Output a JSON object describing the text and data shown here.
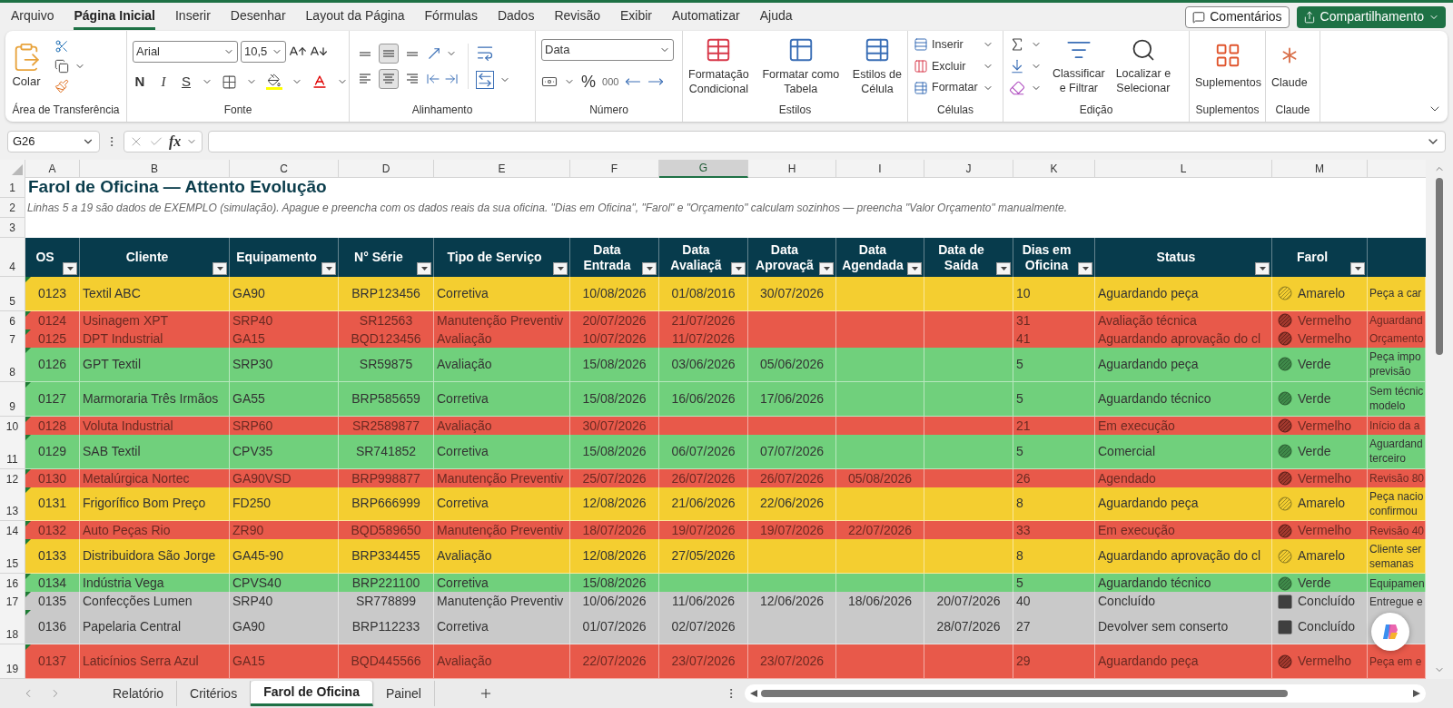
{
  "menu_tabs": [
    {
      "label": "Arquivo",
      "selected": false
    },
    {
      "label": "Página Inicial",
      "selected": true
    },
    {
      "label": "Inserir",
      "selected": false
    },
    {
      "label": "Desenhar",
      "selected": false
    },
    {
      "label": "Layout da Página",
      "selected": false
    },
    {
      "label": "Fórmulas",
      "selected": false
    },
    {
      "label": "Dados",
      "selected": false
    },
    {
      "label": "Revisão",
      "selected": false
    },
    {
      "label": "Exibir",
      "selected": false
    },
    {
      "label": "Automatizar",
      "selected": false
    },
    {
      "label": "Ajuda",
      "selected": false
    }
  ],
  "header_buttons": {
    "comments": "Comentários",
    "share": "Compartilhamento"
  },
  "ribbon": {
    "clipboard": {
      "paste": "Colar",
      "group": "Área de Transferência"
    },
    "font": {
      "name": "Arial",
      "size": "10,5",
      "bold": "N",
      "italic": "I",
      "underline": "S",
      "group": "Fonte"
    },
    "alignment": {
      "vertical": [
        {
          "kind": "top",
          "selected": false
        },
        {
          "kind": "middle",
          "selected": true
        },
        {
          "kind": "bottom",
          "selected": false
        }
      ],
      "horizontal": [
        {
          "kind": "left",
          "selected": false
        },
        {
          "kind": "center",
          "selected": true
        },
        {
          "kind": "right",
          "selected": false
        }
      ],
      "group": "Alinhamento"
    },
    "number": {
      "format": "Data",
      "percent": "%",
      "thousands": "000",
      "group": "Número"
    },
    "styles": {
      "buttons": [
        {
          "lines": [
            "Formatação",
            "Condicional"
          ]
        },
        {
          "lines": [
            "Formatar como",
            "Tabela"
          ]
        },
        {
          "lines": [
            "Estilos de",
            "Célula"
          ]
        }
      ],
      "group": "Estilos"
    },
    "cells": {
      "buttons": [
        "Inserir",
        "Excluir",
        "Formatar"
      ],
      "group": "Células"
    },
    "editing": {
      "buttons": [
        {
          "lines": [
            "Classificar",
            "e Filtrar"
          ]
        },
        {
          "lines": [
            "Localizar e",
            "Selecionar"
          ]
        }
      ],
      "group": "Edição"
    },
    "addins": {
      "button": "Suplementos",
      "group": "Suplementos"
    },
    "claude": {
      "button": "Claude",
      "group": "Claude"
    }
  },
  "formula_bar": {
    "name_box": "G26",
    "fx": "fx"
  },
  "columns": [
    {
      "letter": "A",
      "selected": false
    },
    {
      "letter": "B",
      "selected": false
    },
    {
      "letter": "C",
      "selected": false
    },
    {
      "letter": "D",
      "selected": false
    },
    {
      "letter": "E",
      "selected": false
    },
    {
      "letter": "F",
      "selected": false
    },
    {
      "letter": "G",
      "selected": true
    },
    {
      "letter": "H",
      "selected": false
    },
    {
      "letter": "I",
      "selected": false
    },
    {
      "letter": "J",
      "selected": false
    },
    {
      "letter": "K",
      "selected": false
    },
    {
      "letter": "L",
      "selected": false
    },
    {
      "letter": "M",
      "selected": false
    }
  ],
  "title": {
    "num": "1",
    "text": "Farol de Oficina — Attento Evolução"
  },
  "subtitle": {
    "num": "2",
    "text": "Linhas 5 a 19 são dados de EXEMPLO (simulação). Apague e preencha com os dados reais da sua oficina. \"Dias em Oficina\", \"Farol\" e \"Orçamento\" calculam sozinhos — preencha \"Valor Orçamento\" manualmente."
  },
  "blank_row": {
    "num": "3"
  },
  "table": {
    "num": "4",
    "headers": [
      {
        "lines": [
          "OS"
        ]
      },
      {
        "lines": [
          "Cliente"
        ]
      },
      {
        "lines": [
          "Equipamento"
        ]
      },
      {
        "lines": [
          "N° Série"
        ]
      },
      {
        "lines": [
          "Tipo de Serviço"
        ]
      },
      {
        "lines": [
          "Data",
          "Entrada"
        ]
      },
      {
        "lines": [
          "Data",
          "Avaliaçã"
        ]
      },
      {
        "lines": [
          "Data",
          "Aprovaçã"
        ]
      },
      {
        "lines": [
          "Data",
          "Agendada"
        ]
      },
      {
        "lines": [
          "Data de",
          "Saída"
        ]
      },
      {
        "lines": [
          "Dias em",
          "Oficina"
        ]
      },
      {
        "lines": [
          "Status"
        ]
      },
      {
        "lines": [
          "Farol"
        ]
      }
    ],
    "rows": [
      {
        "num": "5",
        "kind": "yellow",
        "cells": {
          "A": "0123",
          "B": "Textil ABC",
          "C": "GA90",
          "D": "BRP123456",
          "E": "Corretiva",
          "F": "10/08/2026",
          "G": "01/08/2016",
          "H": "30/07/2026",
          "K": "10",
          "L": "Aguardando peça",
          "M": "Amarelo"
        },
        "note": [
          "Peça a car"
        ]
      },
      {
        "num": "6",
        "kind": "red",
        "cells": {
          "A": "0124",
          "B": "Usinagem XPT",
          "C": "SRP40",
          "D": "SR12563",
          "E": "Manutenção Preventiv",
          "F": "20/07/2026",
          "G": "21/07/2026",
          "K": "31",
          "L": "Avaliação técnica",
          "M": "Vermelho"
        },
        "note": [
          "Aguardand"
        ]
      },
      {
        "num": "7",
        "kind": "red",
        "cells": {
          "A": "0125",
          "B": "DPT Industrial",
          "C": "GA15",
          "D": "BQD123456",
          "E": "Avaliação",
          "F": "10/07/2026",
          "G": "11/07/2026",
          "K": "41",
          "L": "Aguardando aprovação do cl",
          "M": "Vermelho"
        },
        "note": [
          "Orçamento"
        ]
      },
      {
        "num": "8",
        "kind": "green",
        "cells": {
          "A": "0126",
          "B": "GPT Textil",
          "C": "SRP30",
          "D": "SR59875",
          "E": "Avaliação",
          "F": "15/08/2026",
          "G": "03/06/2026",
          "H": "05/06/2026",
          "K": "5",
          "L": "Aguardando peça",
          "M": "Verde"
        },
        "note": [
          "Peça impo",
          "previsão"
        ]
      },
      {
        "num": "9",
        "kind": "green",
        "cells": {
          "A": "0127",
          "B": "Marmoraria Três Irmãos",
          "C": "GA55",
          "D": "BRP585659",
          "E": "Corretiva",
          "F": "15/08/2026",
          "G": "16/06/2026",
          "H": "17/06/2026",
          "K": "5",
          "L": "Aguardando técnico",
          "M": "Verde"
        },
        "note": [
          "Sem técnic",
          "modelo"
        ]
      },
      {
        "num": "10",
        "kind": "red",
        "cells": {
          "A": "0128",
          "B": "Voluta Industrial",
          "C": "SRP60",
          "D": "SR2589877",
          "E": "Avaliação",
          "F": "30/07/2026",
          "K": "21",
          "L": "Em execução",
          "M": "Vermelho"
        },
        "note": [
          "Início da a"
        ]
      },
      {
        "num": "11",
        "kind": "green",
        "cells": {
          "A": "0129",
          "B": "SAB Textil",
          "C": "CPV35",
          "D": "SR741852",
          "E": "Corretiva",
          "F": "15/08/2026",
          "G": "06/07/2026",
          "H": "07/07/2026",
          "K": "5",
          "L": "Comercial",
          "M": "Verde"
        },
        "note": [
          "Aguardand",
          "terceiro"
        ]
      },
      {
        "num": "12",
        "kind": "red",
        "cells": {
          "A": "0130",
          "B": "Metalúrgica Nortec",
          "C": "GA90VSD",
          "D": "BRP998877",
          "E": "Manutenção Preventiv",
          "F": "25/07/2026",
          "G": "26/07/2026",
          "H": "26/07/2026",
          "I": "05/08/2026",
          "K": "26",
          "L": "Agendado",
          "M": "Vermelho"
        },
        "note": [
          "Revisão 80"
        ]
      },
      {
        "num": "13",
        "kind": "yellow",
        "cells": {
          "A": "0131",
          "B": "Frigorífico Bom Preço",
          "C": "FD250",
          "D": "BRP666999",
          "E": "Corretiva",
          "F": "12/08/2026",
          "G": "21/06/2026",
          "H": "22/06/2026",
          "K": "8",
          "L": "Aguardando peça",
          "M": "Amarelo"
        },
        "note": [
          "Peça nacio",
          "confirmou"
        ]
      },
      {
        "num": "14",
        "kind": "red",
        "cells": {
          "A": "0132",
          "B": "Auto Peças Rio",
          "C": "ZR90",
          "D": "BQD589650",
          "E": "Manutenção Preventiv",
          "F": "18/07/2026",
          "G": "19/07/2026",
          "H": "19/07/2026",
          "I": "22/07/2026",
          "K": "33",
          "L": "Em execução",
          "M": "Vermelho"
        },
        "note": [
          "Revisão 40"
        ]
      },
      {
        "num": "15",
        "kind": "yellow",
        "cells": {
          "A": "0133",
          "B": "Distribuidora São Jorge",
          "C": "GA45-90",
          "D": "BRP334455",
          "E": "Avaliação",
          "F": "12/08/2026",
          "G": "27/05/2026",
          "K": "8",
          "L": "Aguardando aprovação do cl",
          "M": "Amarelo"
        },
        "note": [
          "Cliente ser",
          "semanas"
        ]
      },
      {
        "num": "16",
        "kind": "green",
        "cells": {
          "A": "0134",
          "B": "Indústria Vega",
          "C": "CPVS40",
          "D": "BRP221100",
          "E": "Corretiva",
          "F": "15/08/2026",
          "K": "5",
          "L": "Aguardando técnico",
          "M": "Verde"
        },
        "note": [
          "Equipamen"
        ]
      },
      {
        "num": "17",
        "kind": "done",
        "cells": {
          "A": "0135",
          "B": "Confecções Lumen",
          "C": "SRP40",
          "D": "SR778899",
          "E": "Manutenção Preventiv",
          "F": "10/06/2026",
          "G": "11/06/2026",
          "H": "12/06/2026",
          "I": "18/06/2026",
          "J": "20/07/2026",
          "K": "40",
          "L": "Concluído",
          "M": "Concluído"
        },
        "note": [
          "Entregue e"
        ]
      },
      {
        "num": "18",
        "kind": "done",
        "cells": {
          "A": "0136",
          "B": "Papelaria Central",
          "C": "GA90",
          "D": "BRP112233",
          "E": "Corretiva",
          "F": "01/07/2026",
          "G": "02/07/2026",
          "J": "28/07/2026",
          "K": "27",
          "L": "Devolver sem conserto",
          "M": "Concluído"
        }
      },
      {
        "num": "19",
        "kind": "red",
        "cells": {
          "A": "0137",
          "B": "Laticínios Serra Azul",
          "C": "GA15",
          "D": "BQD445566",
          "E": "Avaliação",
          "F": "22/07/2026",
          "G": "23/07/2026",
          "H": "23/07/2026",
          "K": "29",
          "L": "Aguardando peça",
          "M": "Vermelho"
        },
        "note": [
          "Peça em e"
        ]
      }
    ]
  },
  "sheet_tabs": [
    {
      "label": "Relatório",
      "selected": false
    },
    {
      "label": "Critérios",
      "selected": false
    },
    {
      "label": "Farol de Oficina",
      "selected": true
    },
    {
      "label": "Painel",
      "selected": false
    }
  ]
}
